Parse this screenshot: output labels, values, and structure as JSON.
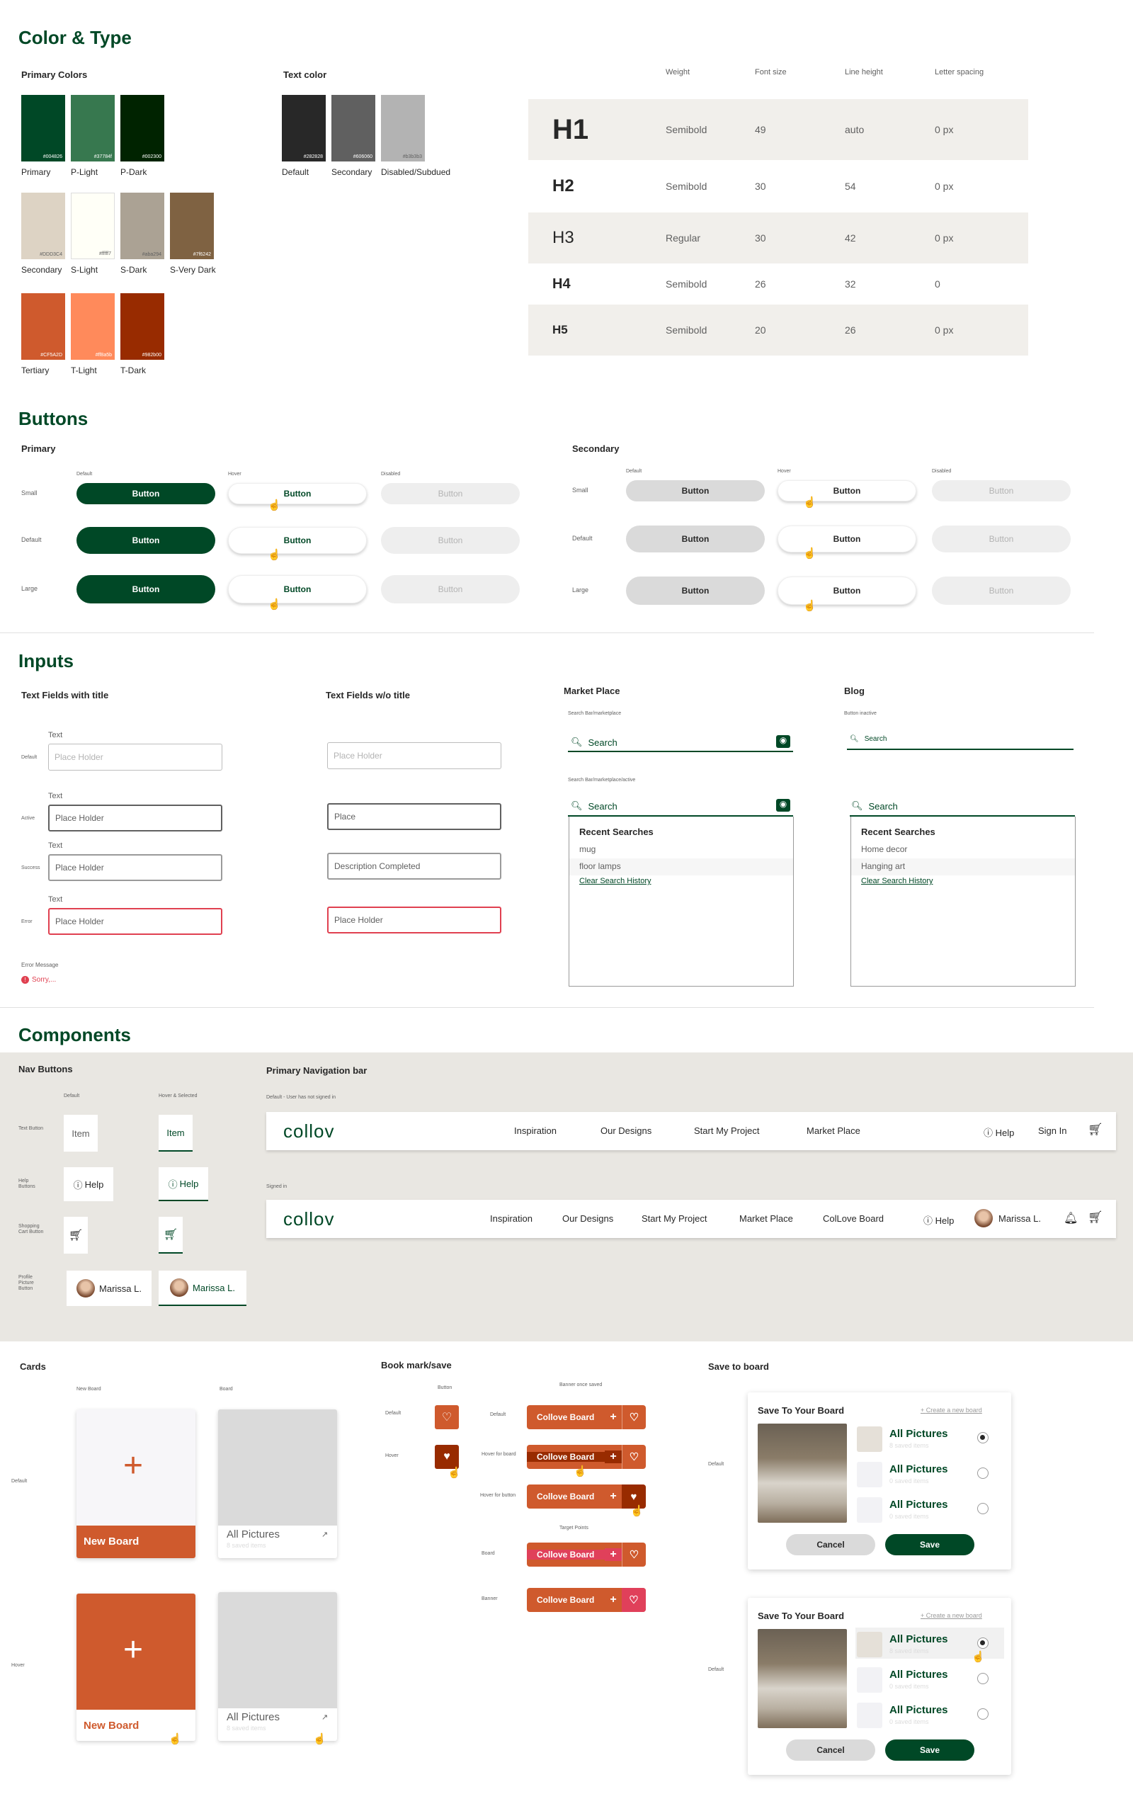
{
  "sections": {
    "color_type": "Color & Type",
    "buttons": "Buttons",
    "inputs": "Inputs",
    "components": "Components"
  },
  "colors": {
    "primary_title": "Primary Colors",
    "text_title": "Text color",
    "primary": [
      {
        "hex": "#004826",
        "name": "Primary"
      },
      {
        "hex": "#37784f",
        "name": "P-Light"
      },
      {
        "hex": "#002300",
        "name": "P-Dark"
      }
    ],
    "secondary": [
      {
        "hex": "#DDD3C4",
        "name": "Secondary"
      },
      {
        "hex": "#fffff7",
        "name": "S-Light"
      },
      {
        "hex": "#aba294",
        "name": "S-Dark"
      },
      {
        "hex": "#7f6242",
        "name": "S-Very Dark"
      }
    ],
    "tertiary": [
      {
        "hex": "#CF5A2D",
        "name": "Tertiary"
      },
      {
        "hex": "#ff8a5b",
        "name": "T-Light"
      },
      {
        "hex": "#982b00",
        "name": "T-Dark"
      }
    ],
    "text": [
      {
        "hex": "#282828",
        "name": "Default"
      },
      {
        "hex": "#606060",
        "name": "Secondary"
      },
      {
        "hex": "#b3b3b3",
        "name": "Disabled/Subdued"
      }
    ]
  },
  "type": {
    "headers": [
      "Weight",
      "Font size",
      "Line height",
      "Letter spacing"
    ],
    "rows": [
      {
        "tag": "H1",
        "weight": "Semibold",
        "size": "49",
        "line": "auto",
        "spacing": "0 px"
      },
      {
        "tag": "H2",
        "weight": "Semibold",
        "size": "30",
        "line": "54",
        "spacing": "0 px"
      },
      {
        "tag": "H3",
        "weight": "Regular",
        "size": "30",
        "line": "42",
        "spacing": "0 px"
      },
      {
        "tag": "H4",
        "weight": "Semibold",
        "size": "26",
        "line": "32",
        "spacing": "0"
      },
      {
        "tag": "H5",
        "weight": "Semibold",
        "size": "20",
        "line": "26",
        "spacing": "0 px"
      }
    ]
  },
  "buttons": {
    "primary_title": "Primary",
    "secondary_title": "Secondary",
    "states": [
      "Default",
      "Hover",
      "Disabled"
    ],
    "sizes": [
      "Small",
      "Default",
      "Large"
    ],
    "label": "Button"
  },
  "inputs": {
    "with_title": "Text Fields with title",
    "without_title": "Text Fields w/o title",
    "field_label": "Text",
    "states": [
      "Default",
      "Active",
      "Success",
      "Error"
    ],
    "with": [
      "Place Holder",
      "Place Holder",
      "Place Holder",
      "Place Holder"
    ],
    "without": [
      "Place Holder",
      "Place",
      "Description Completed",
      "Place Holder"
    ],
    "error_message_label": "Error Message",
    "error_text": "Sorry,...",
    "marketplace_title": "Market Place",
    "blog_title": "Blog",
    "mp_inactive_label": "Search Bar/marketplace",
    "mp_active_label": "Search Bar/marketplace/active",
    "blog_inactive_label": "Button inactive",
    "search": "Search",
    "recent_title": "Recent Searches",
    "mp_recent": [
      "mug",
      "floor lamps"
    ],
    "blog_recent": [
      "Home decor",
      "Hanging art"
    ],
    "clear": "Clear Search History"
  },
  "components": {
    "nav_buttons_title": "Nav Buttons",
    "nav_bar_title": "Primary Navigation bar",
    "col_default": "Default",
    "col_hover": "Hover & Selected",
    "row_labels": [
      "Text Button",
      "Help Buttons",
      "Shopping Cart Button",
      "Profile Picture Button"
    ],
    "item": "Item",
    "help": "Help",
    "user": "Marissa L.",
    "bar1_label": "Default - User has not signed in",
    "bar2_label": "Signed in",
    "logo": "collov",
    "bar1_links": [
      "Inspiration",
      "Our Designs",
      "Start My Project",
      "Market Place"
    ],
    "bar2_links": [
      "Inspiration",
      "Our Designs",
      "Start My Project",
      "Market Place",
      "ColLove Board"
    ],
    "sign_in": "Sign In"
  },
  "cards": {
    "title": "Cards",
    "new_board_col": "New Board",
    "board_col": "Board",
    "default_label": "Default",
    "hover_label": "Hover",
    "new_board": "New Board",
    "all_pictures": "All Pictures",
    "saved": "8 saved items"
  },
  "bookmark": {
    "title": "Book mark/save",
    "button_col": "Button",
    "banner_col": "Banner once saved",
    "default_label": "Default",
    "hover_label": "Hover",
    "hover_board": "Hover for board",
    "hover_button": "Hover for button",
    "target_points": "Target Points",
    "board_label": "Board",
    "banner_label": "Banner",
    "board_name": "Collove Board"
  },
  "save": {
    "title": "Save to board",
    "modal_title": "Save To Your Board",
    "create": "Create a new board",
    "default_label": "Default",
    "rows": [
      {
        "name": "All Pictures",
        "count": "8 saved items"
      },
      {
        "name": "All Pictures",
        "count": "0 saved items"
      },
      {
        "name": "All Pictures",
        "count": "0 saved items"
      }
    ],
    "cancel": "Cancel",
    "save": "Save"
  }
}
